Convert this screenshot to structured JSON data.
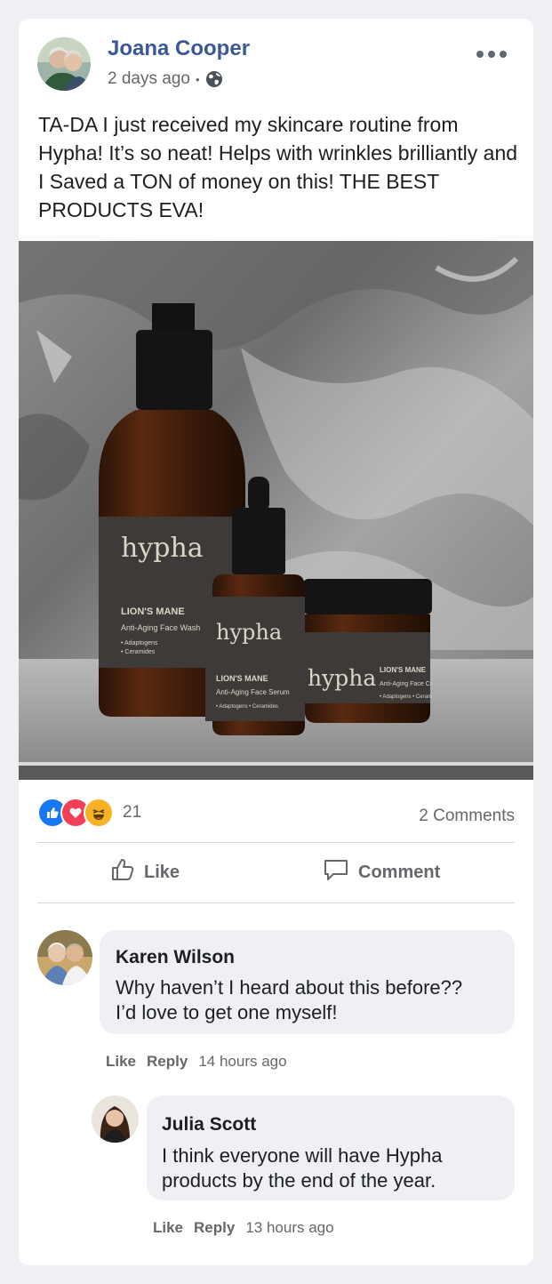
{
  "post": {
    "author": "Joana Cooper",
    "time": "2 days ago",
    "separator": "•",
    "text": "TA-DA I just received my skincare routine from Hypha! It’s so neat! Helps with wrinkles brilliantly and I Saved a TON of money on this! THE BEST PRODUCTS EVA!"
  },
  "product_image": {
    "big_bottle": {
      "brand": "hypha",
      "line1": "LION'S MANE",
      "line2": "Anti-Aging Face Wash",
      "b1": "• Adaptogens",
      "b2": "• Ceramides"
    },
    "small_bottle": {
      "brand": "hypha",
      "line1": "LION'S MANE",
      "line2": "Anti-Aging Face Serum",
      "b1": "• Adaptogens • Ceramides"
    },
    "jar": {
      "brand": "hypha",
      "line1": "LION'S MANE",
      "line2": "Anti-Aging Face Cr",
      "b1": "• Adaptogens • Ceram"
    }
  },
  "stats": {
    "reaction_count": "21",
    "comments_count": "2 Comments",
    "reaction_icons": [
      "like-icon",
      "love-icon",
      "haha-icon"
    ]
  },
  "actions": {
    "like": "Like",
    "comment": "Comment"
  },
  "comments": [
    {
      "name": "Karen Wilson",
      "text_line1": "Why haven’t I heard about this before??",
      "text_line2": "I’d love to get one myself!",
      "like": "Like",
      "reply": "Reply",
      "time": "14 hours ago"
    },
    {
      "name": "Julia Scott",
      "text_line1": "I think everyone will have Hypha",
      "text_line2": "products by the end of the year.",
      "like": "Like",
      "reply": "Reply",
      "time": "13 hours ago"
    }
  ],
  "colors": {
    "name_blue": "#385898",
    "like_blue": "#1877f2",
    "love_red": "#f33e58",
    "haha_yellow": "#f7b125"
  }
}
